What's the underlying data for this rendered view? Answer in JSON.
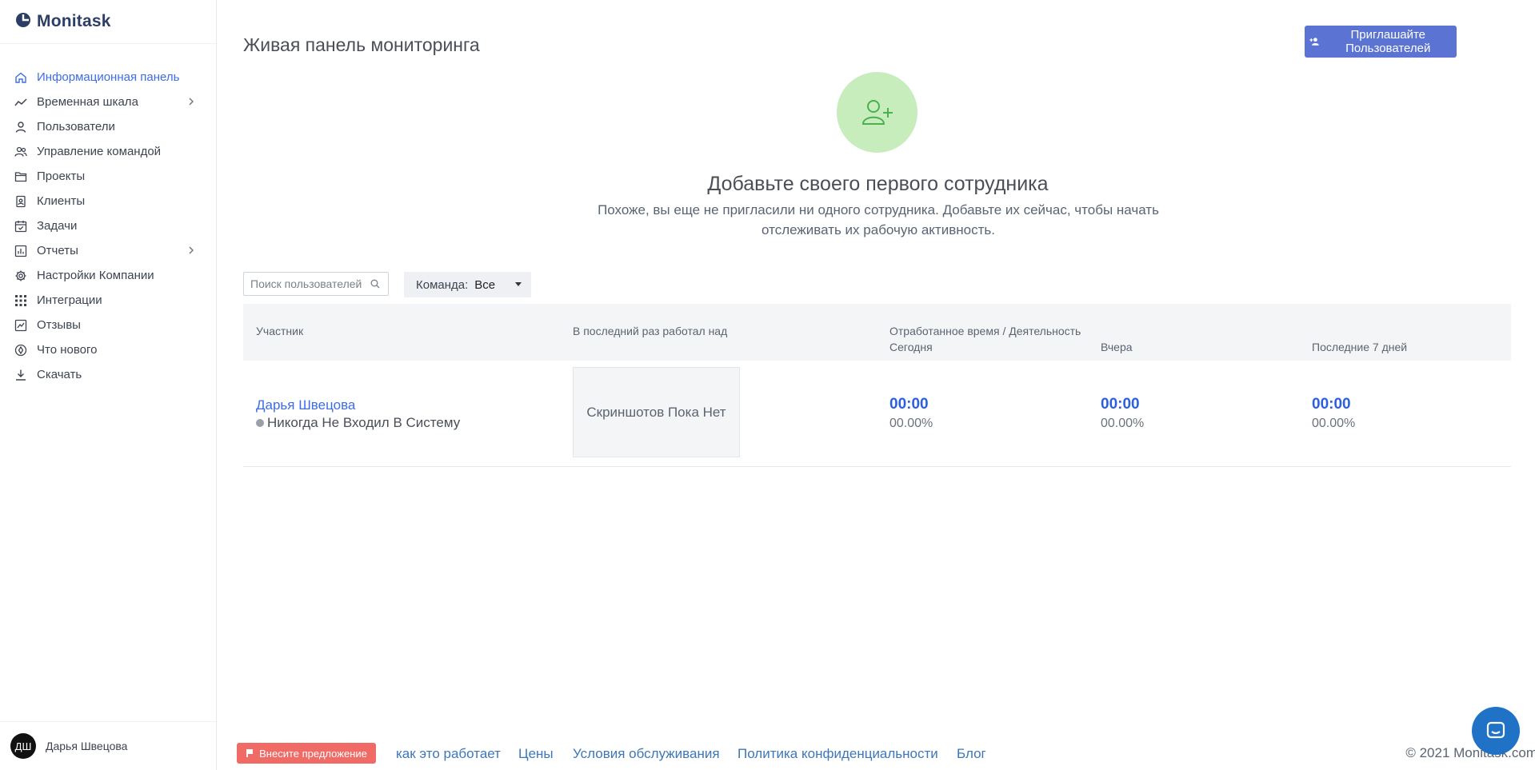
{
  "brand": {
    "name": "Monitask"
  },
  "sidebar": {
    "items": [
      {
        "label": "Информационная панель",
        "icon": "home-icon",
        "active": true,
        "submenu": false
      },
      {
        "label": "Временная шкала",
        "icon": "timeline-icon",
        "active": false,
        "submenu": true
      },
      {
        "label": "Пользователи",
        "icon": "user-icon",
        "active": false,
        "submenu": false
      },
      {
        "label": "Управление командой",
        "icon": "team-icon",
        "active": false,
        "submenu": false
      },
      {
        "label": "Проекты",
        "icon": "folder-icon",
        "active": false,
        "submenu": false
      },
      {
        "label": "Клиенты",
        "icon": "client-icon",
        "active": false,
        "submenu": false
      },
      {
        "label": "Задачи",
        "icon": "calendar-check-icon",
        "active": false,
        "submenu": false
      },
      {
        "label": "Отчеты",
        "icon": "bar-chart-icon",
        "active": false,
        "submenu": true
      },
      {
        "label": "Настройки Компании",
        "icon": "gear-icon",
        "active": false,
        "submenu": false
      },
      {
        "label": "Интеграции",
        "icon": "grid-icon",
        "active": false,
        "submenu": false
      },
      {
        "label": "Отзывы",
        "icon": "feedback-icon",
        "active": false,
        "submenu": false
      },
      {
        "label": "Что нового",
        "icon": "badge-icon",
        "active": false,
        "submenu": false
      },
      {
        "label": "Скачать",
        "icon": "download-icon",
        "active": false,
        "submenu": false
      }
    ],
    "user": {
      "initials": "ДШ",
      "name": "Дарья Швецова"
    }
  },
  "header": {
    "title": "Живая панель мониторинга",
    "invite_label": "Приглашайте Пользователей"
  },
  "empty_state": {
    "title": "Добавьте своего первого сотрудника",
    "description": "Похоже, вы еще не пригласили ни одного сотрудника. Добавьте их сейчас, чтобы начать отслеживать их рабочую активность."
  },
  "filters": {
    "search_placeholder": "Поиск пользователей",
    "team_label": "Команда:",
    "team_value": "Все"
  },
  "table": {
    "headers": {
      "member": "Участник",
      "last_worked": "В последний раз работал над",
      "worked_time": "Отработанное время / Деятельность",
      "today": "Сегодня",
      "yesterday": "Вчера",
      "last7": "Последние 7 дней"
    },
    "rows": [
      {
        "name": "Дарья Швецова",
        "status": "Никогда Не Входил В Систему",
        "screenshot_text": "Скриншотов Пока Нет",
        "today_time": "00:00",
        "today_pct": "00.00%",
        "yesterday_time": "00:00",
        "yesterday_pct": "00.00%",
        "last7_time": "00:00",
        "last7_pct": "00.00%"
      }
    ]
  },
  "footer": {
    "suggest_label": "Внесите предложение",
    "links": [
      "как это работает",
      "Цены",
      "Условия обслуживания",
      "Политика конфиденциальности",
      "Блог"
    ],
    "copyright": "© 2021 Monitask.com"
  },
  "colors": {
    "accent": "#3d6ce8",
    "invite_button": "#5b73d3",
    "suggest_button": "#f06b66",
    "chat_button": "#1f72c6",
    "empty_circle": "#c7edbd"
  }
}
